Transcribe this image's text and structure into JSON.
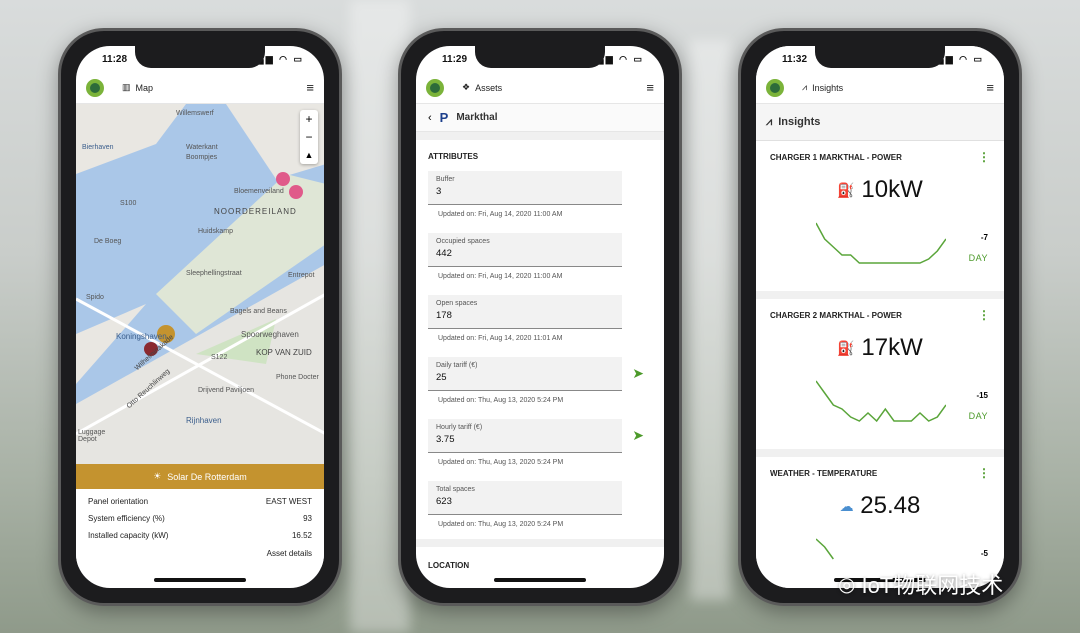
{
  "phones": [
    {
      "time": "11:28",
      "nav_title": "Map",
      "map_labels": [
        "Willemswerf",
        "Boompjes",
        "Waterkant",
        "Bierhaven",
        "Bloemenveiland",
        "NOORDEREILAND",
        "S100",
        "Huidskamp",
        "De Boeg",
        "Sleephellingstraat",
        "Entrepot",
        "Spido",
        "Koningshaven",
        "Bagels and Beans",
        "Spoorweghaven",
        "KOP VAN ZUID",
        "S122",
        "Phone Docter",
        "Drijvend Paviljoen",
        "Rijnhaven",
        "Luggage Depot",
        "Wilhelminakade",
        "Otto Reuchlinweg"
      ],
      "popup": {
        "title": "Solar De Rotterdam",
        "icon": "sun-icon",
        "color": "#c4932f",
        "rows": [
          {
            "label": "Panel orientation",
            "value": "EAST WEST"
          },
          {
            "label": "System efficiency (%)",
            "value": "93"
          },
          {
            "label": "Installed capacity (kW)",
            "value": "16.52"
          }
        ],
        "link": "Asset details"
      }
    },
    {
      "time": "11:29",
      "nav_title": "Assets",
      "asset_name": "Markthal",
      "section": "ATTRIBUTES",
      "attributes": [
        {
          "label": "Buffer",
          "value": "3",
          "updated": "Updated on: Fri, Aug 14, 2020 11:00 AM",
          "send": false
        },
        {
          "label": "Occupied spaces",
          "value": "442",
          "updated": "Updated on: Fri, Aug 14, 2020 11:00 AM",
          "send": false
        },
        {
          "label": "Open spaces",
          "value": "178",
          "updated": "Updated on: Fri, Aug 14, 2020 11:01 AM",
          "send": false
        },
        {
          "label": "Daily tariff (€)",
          "value": "25",
          "updated": "Updated on: Thu, Aug 13, 2020 5:24 PM",
          "send": true
        },
        {
          "label": "Hourly tariff (€)",
          "value": "3.75",
          "updated": "Updated on: Thu, Aug 13, 2020 5:24 PM",
          "send": true
        },
        {
          "label": "Total spaces",
          "value": "623",
          "updated": "Updated on: Thu, Aug 13, 2020 5:24 PM",
          "send": false
        }
      ],
      "section2": "LOCATION"
    },
    {
      "time": "11:32",
      "nav_title": "Insights",
      "page_title": "Insights",
      "cards": [
        {
          "title": "CHARGER 1 MARKTHAL - POWER",
          "value": "10",
          "unit": "kW",
          "min": "-7",
          "period": "DAY",
          "icon": "ev-charger-icon",
          "spark": [
            10,
            6,
            4,
            2,
            2,
            0,
            0,
            0,
            0,
            0,
            0,
            0,
            0,
            1,
            3,
            6
          ]
        },
        {
          "title": "CHARGER 2 MARKTHAL - POWER",
          "value": "17",
          "unit": "kW",
          "min": "-15",
          "period": "DAY",
          "icon": "ev-charger-icon",
          "spark": [
            10,
            7,
            4,
            3,
            1,
            0,
            2,
            0,
            3,
            0,
            0,
            0,
            2,
            0,
            1,
            4
          ]
        },
        {
          "title": "WEATHER - TEMPERATURE",
          "value": "25.48",
          "unit": "",
          "min": "-5",
          "period": "",
          "icon": "cloud-sun-icon",
          "spark": [
            10,
            8,
            5
          ]
        }
      ]
    }
  ],
  "watermark": "IoT物联网技术",
  "colors": {
    "accent": "#4c9a2a",
    "solar": "#c4932f",
    "charger": "#8b2a30"
  }
}
